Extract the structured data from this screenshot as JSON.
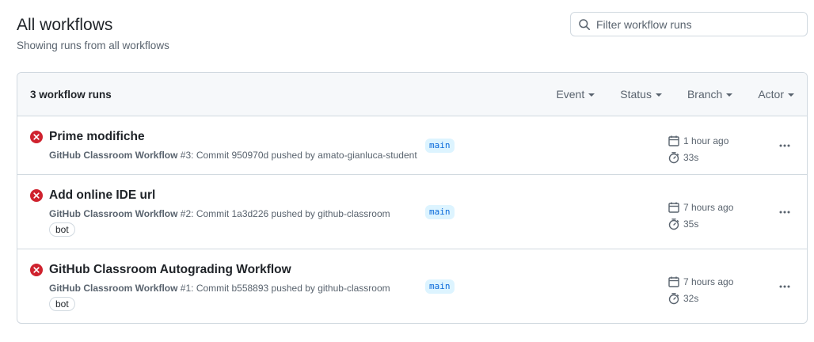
{
  "header": {
    "title": "All workflows",
    "subtitle": "Showing runs from all workflows"
  },
  "search": {
    "placeholder": "Filter workflow runs",
    "value": ""
  },
  "runs_box": {
    "count_label": "3 workflow runs",
    "filters": [
      "Event",
      "Status",
      "Branch",
      "Actor"
    ]
  },
  "runs": [
    {
      "status": "failed",
      "status_icon": "x-circle-fill-icon",
      "title": "Prime modifiche",
      "workflow": "GitHub Classroom Workflow",
      "detail": " #3: Commit 950970d pushed by amato-gianluca-student",
      "bot": "",
      "branch": "main",
      "when": "1 hour ago",
      "duration": "33s"
    },
    {
      "status": "failed",
      "status_icon": "x-circle-fill-icon",
      "title": "Add online IDE url",
      "workflow": "GitHub Classroom Workflow",
      "detail": " #2: Commit 1a3d226 pushed by github-classroom",
      "bot": "bot",
      "branch": "main",
      "when": "7 hours ago",
      "duration": "35s"
    },
    {
      "status": "failed",
      "status_icon": "x-circle-fill-icon",
      "title": "GitHub Classroom Autograding Workflow",
      "workflow": "GitHub Classroom Workflow",
      "detail": " #1: Commit b558893 pushed by github-classroom",
      "bot": "bot",
      "branch": "main",
      "when": "7 hours ago",
      "duration": "32s"
    }
  ],
  "colors": {
    "failure": "#cf222e",
    "branch_bg": "#ddf4ff",
    "branch_fg": "#0969da",
    "border": "#d1d9e0",
    "header_bg": "#f6f8fa"
  }
}
